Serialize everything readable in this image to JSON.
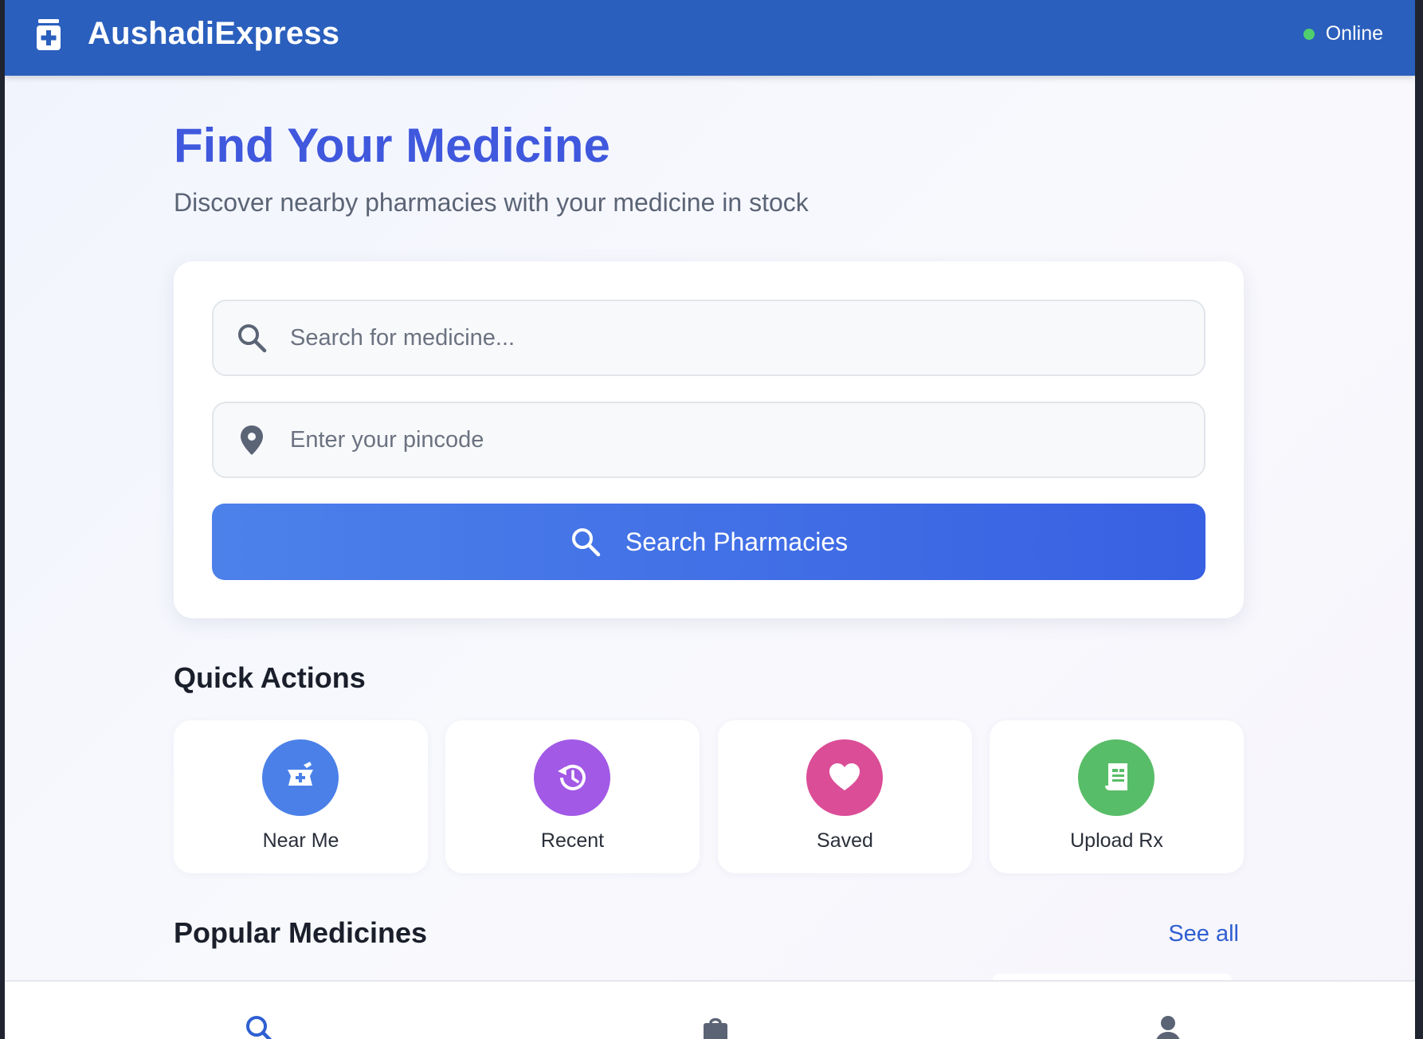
{
  "app": {
    "brand": "AushadiExpress",
    "status": "Online",
    "status_color": "#4fcf6d",
    "header_color": "#2a5fbd"
  },
  "hero": {
    "title": "Find Your Medicine",
    "subtitle": "Discover nearby pharmacies with your medicine in stock"
  },
  "search": {
    "medicine_placeholder": "Search for medicine...",
    "medicine_value": "",
    "pincode_placeholder": "Enter your pincode",
    "pincode_value": "",
    "button_label": "Search Pharmacies",
    "medicine_icon": "search-icon",
    "pincode_icon": "location-pin-icon"
  },
  "quick_actions": {
    "title": "Quick Actions",
    "items": [
      {
        "label": "Near Me",
        "icon": "pharmacy-mortar-icon",
        "color": "#4a80e8"
      },
      {
        "label": "Recent",
        "icon": "history-icon",
        "color": "#a259e6"
      },
      {
        "label": "Saved",
        "icon": "heart-icon",
        "color": "#db4d96"
      },
      {
        "label": "Upload Rx",
        "icon": "prescription-icon",
        "color": "#58bd68"
      }
    ]
  },
  "popular": {
    "title": "Popular Medicines",
    "see_all": "See all"
  },
  "bottom_nav": {
    "items": [
      {
        "icon": "search-icon",
        "active": true
      },
      {
        "icon": "shopping-bag-icon",
        "active": false
      },
      {
        "icon": "user-icon",
        "active": false
      }
    ]
  }
}
